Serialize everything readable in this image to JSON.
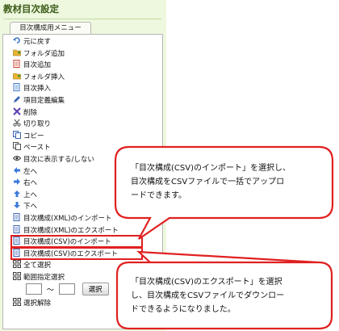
{
  "page_title": "教材目次設定",
  "tab_label": "目次構成用メニュー",
  "menu_items": [
    {
      "label": "元に戻す",
      "icon": "undo-icon",
      "color": "#3c78c8"
    },
    {
      "label": "フォルダ追加",
      "icon": "folder-add-icon",
      "color": "#e8b432"
    },
    {
      "label": "目次追加",
      "icon": "toc-add-icon",
      "color": "#d24632"
    },
    {
      "label": "フォルダ挿入",
      "icon": "folder-insert-icon",
      "color": "#e8b432"
    },
    {
      "label": "目次挿入",
      "icon": "toc-insert-icon",
      "color": "#3c78c8"
    },
    {
      "label": "項目定義編集",
      "icon": "pencil-icon",
      "color": "#3c64b4"
    },
    {
      "label": "削除",
      "icon": "delete-x-icon",
      "color": "#5a3cb4"
    },
    {
      "label": "切り取り",
      "icon": "scissors-icon",
      "color": "#505050"
    },
    {
      "label": "コピー",
      "icon": "copy-icon",
      "color": "#3c64b4"
    },
    {
      "label": "ペースト",
      "icon": "paste-icon",
      "color": "#505050"
    },
    {
      "label": "目次に表示する/しない",
      "icon": "eye-icon",
      "color": "#3c3c3c"
    },
    {
      "label": "左へ",
      "icon": "arrow-left-icon",
      "color": "#3c78dc"
    },
    {
      "label": "右へ",
      "icon": "arrow-right-icon",
      "color": "#3c78dc"
    },
    {
      "label": "上へ",
      "icon": "arrow-up-icon",
      "color": "#3c78dc"
    },
    {
      "label": "下へ",
      "icon": "arrow-down-icon",
      "color": "#3c78dc"
    },
    {
      "label": "目次構成(XML)のインポート",
      "icon": "xml-import-icon",
      "color": "#3c64b4"
    },
    {
      "label": "目次構成(XML)のエクスポート",
      "icon": "xml-export-icon",
      "color": "#3c64b4"
    },
    {
      "label": "目次構成(CSV)のインポート",
      "icon": "csv-import-icon",
      "color": "#3c64b4"
    },
    {
      "label": "目次構成(CSV)のエクスポート",
      "icon": "csv-export-icon",
      "color": "#3c64b4"
    },
    {
      "label": "全て選択",
      "icon": "select-all-icon",
      "color": "#3c3c3c"
    },
    {
      "label": "範囲指定選択",
      "icon": "range-select-icon",
      "color": "#3c3c3c"
    },
    {
      "label": "選択解除",
      "icon": "deselect-icon",
      "color": "#3c3c3c"
    }
  ],
  "range": {
    "from_value": "",
    "to_value": "",
    "tilde": "〜",
    "button_label": "選択"
  },
  "callouts": [
    {
      "lines": [
        "「目次構成(CSV)のインポート」を選択し、",
        "目次構成をCSVファイルで一括でアップロ",
        "ードできます。"
      ]
    },
    {
      "lines": [
        "「目次構成(CSV)のエクスポート」を選択",
        "し、目次構成をCSVファイルでダウンロー",
        "ドできるようになりました。"
      ]
    }
  ],
  "colors": {
    "panel_bg": "#eef8df",
    "title_green": "#3a5a16",
    "highlight_red": "#e02020"
  }
}
